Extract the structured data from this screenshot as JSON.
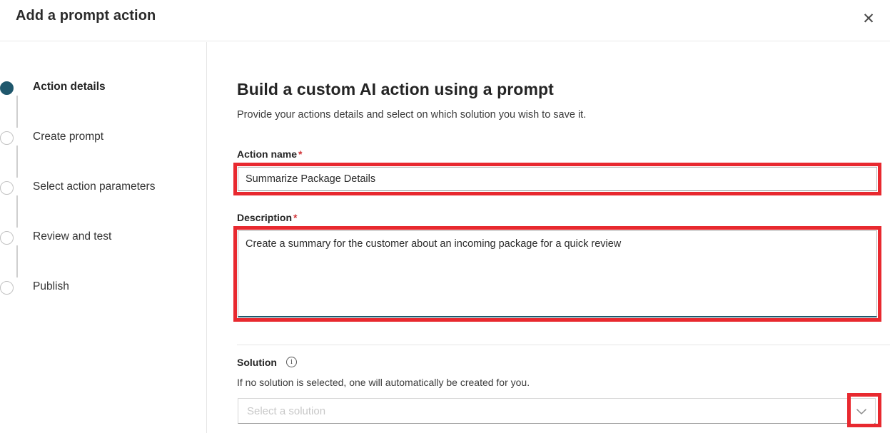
{
  "window": {
    "title": "Add a prompt action",
    "close_icon": "close-icon"
  },
  "sidebar": {
    "steps": [
      {
        "label": "Action details",
        "state": "active",
        "icon": "filled-circle-icon"
      },
      {
        "label": "Create prompt",
        "state": "pending",
        "icon": "empty-circle-icon"
      },
      {
        "label": "Select action parameters",
        "state": "pending",
        "icon": "empty-circle-icon"
      },
      {
        "label": "Review and test",
        "state": "pending",
        "icon": "empty-circle-icon"
      },
      {
        "label": "Publish",
        "state": "pending",
        "icon": "empty-circle-icon"
      }
    ]
  },
  "main": {
    "heading": "Build a custom AI action using a prompt",
    "subheading": "Provide your actions details and select on which solution you wish to save it.",
    "action_name": {
      "label": "Action name",
      "required_marker": "*",
      "value": "Summarize Package Details"
    },
    "description": {
      "label": "Description",
      "required_marker": "*",
      "value": "Create a summary for the customer about an incoming package for a quick review"
    },
    "solution": {
      "label": "Solution",
      "info_icon": "info-icon",
      "info_glyph": "i",
      "helper_text": "If no solution is selected, one will automatically be created for you.",
      "placeholder": "Select a solution",
      "value": "",
      "chevron_icon": "chevron-down-icon"
    }
  },
  "annotations": {
    "highlight_color": "#e8292f",
    "boxes": [
      {
        "target": "action-name-input"
      },
      {
        "target": "description-textarea"
      },
      {
        "target": "solution-dropdown-chevron"
      }
    ]
  },
  "colors": {
    "accent_teal": "#1f576c",
    "required_red": "#d13438",
    "annotation_red": "#e8292f",
    "divider": "#e6e6e6"
  }
}
